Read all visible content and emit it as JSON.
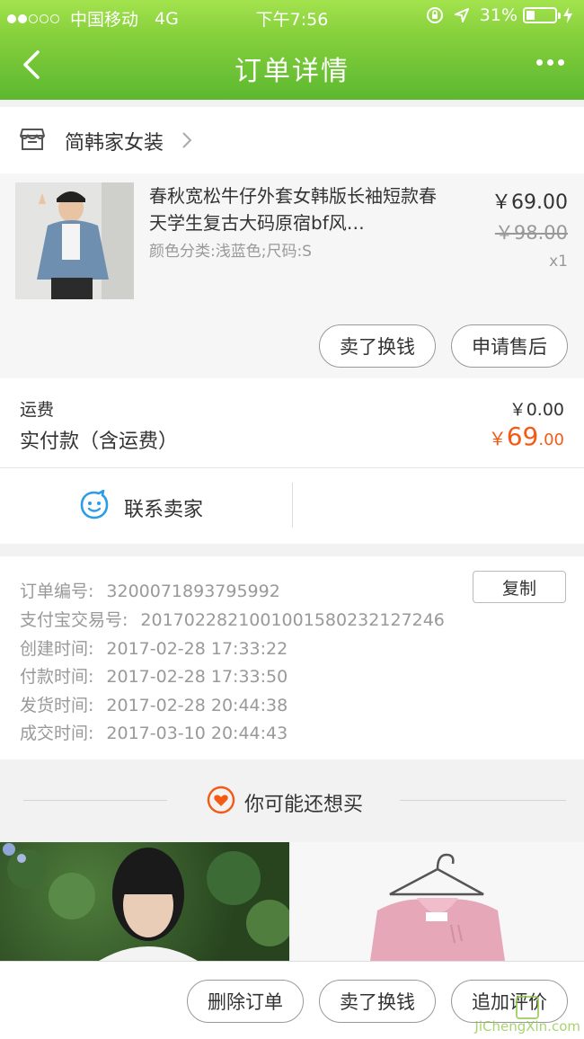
{
  "status_bar": {
    "carrier": "中国移动",
    "network": "4G",
    "time": "下午7:56",
    "battery": "31%",
    "battery_level": 0.31
  },
  "nav": {
    "title": "订单详情"
  },
  "shop": {
    "name": "简韩家女装"
  },
  "item": {
    "title": "春秋宽松牛仔外套女韩版长袖短款春天学生复古大码原宿bf风…",
    "spec": "颜色分类:浅蓝色;尺码:S",
    "price": "￥69.00",
    "original_price": "￥98.00",
    "quantity": "x1",
    "sell_button": "卖了换钱",
    "after_sale_button": "申请售后"
  },
  "fees": {
    "freight_label": "运费",
    "freight_value": "￥0.00",
    "paid_label": "实付款（含运费）",
    "paid_currency": "￥",
    "paid_int": "69",
    "paid_dec": ".00"
  },
  "contact": {
    "label": "联系卖家"
  },
  "order_info": {
    "copy_button": "复制",
    "rows": [
      {
        "label": "订单编号:",
        "value": "3200071893795992"
      },
      {
        "label": "支付宝交易号:",
        "value": "2017022821001001580232127246"
      },
      {
        "label": "创建时间:",
        "value": "2017-02-28 17:33:22"
      },
      {
        "label": "付款时间:",
        "value": "2017-02-28 17:33:50"
      },
      {
        "label": "发货时间:",
        "value": "2017-02-28 20:44:38"
      },
      {
        "label": "成交时间:",
        "value": "2017-03-10 20:44:43"
      }
    ]
  },
  "recommend": {
    "label": "你可能还想买"
  },
  "bottom_bar": {
    "delete_button": "删除订单",
    "sell_button": "卖了换钱",
    "review_button": "追加评价"
  },
  "watermark": {
    "text": "JiChengXin.com"
  },
  "colors": {
    "header_green": "#6cc23a",
    "price_orange": "#f55a15",
    "contact_blue": "#2b9ce8"
  }
}
